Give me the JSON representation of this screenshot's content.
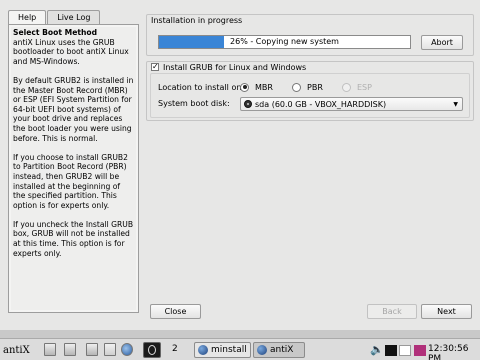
{
  "tabs": [
    {
      "label": "Help",
      "active": true
    },
    {
      "label": "Live Log",
      "active": false
    }
  ],
  "help": {
    "title": "Select Boot Method",
    "paragraphs": [
      "antiX Linux uses the GRUB bootloader to boot antiX Linux and MS-Windows.",
      "By default GRUB2 is installed in the Master Boot Record (MBR) or ESP (EFI System Partition for 64-bit UEFI boot systems) of your boot drive and replaces the boot loader you were using before. This is normal.",
      "If you choose to install GRUB2 to Partition Boot Record (PBR) instead, then GRUB2 will be installed at the beginning of the specified partition. This option is for experts only.",
      "If you uncheck the Install GRUB box, GRUB will not be installed at this time. This option is for experts only."
    ]
  },
  "progress": {
    "heading": "Installation in progress",
    "percent": 26,
    "text": "26% - Copying new system",
    "abort_label": "Abort",
    "fill_color": "#3a85d6"
  },
  "grub": {
    "checkbox_label": "Install GRUB for Linux and Windows",
    "checked": true,
    "location_label": "Location to install on:",
    "options": [
      {
        "label": "MBR",
        "checked": true,
        "disabled": false
      },
      {
        "label": "PBR",
        "checked": false,
        "disabled": false
      },
      {
        "label": "ESP",
        "checked": false,
        "disabled": true
      }
    ],
    "disk_label": "System boot disk:",
    "disk_value": "sda (60.0 GB - VBOX_HARDDISK)",
    "disk_icon": "hard-disk-icon"
  },
  "buttons": {
    "close": "Close",
    "back": "Back",
    "next": "Next"
  },
  "taskbar": {
    "logo": "antiX",
    "workspace": "2",
    "tasks": [
      {
        "label": "minstall",
        "active": false
      },
      {
        "label": "antiX",
        "active": true
      }
    ],
    "clock": "12:30:56 PM"
  }
}
